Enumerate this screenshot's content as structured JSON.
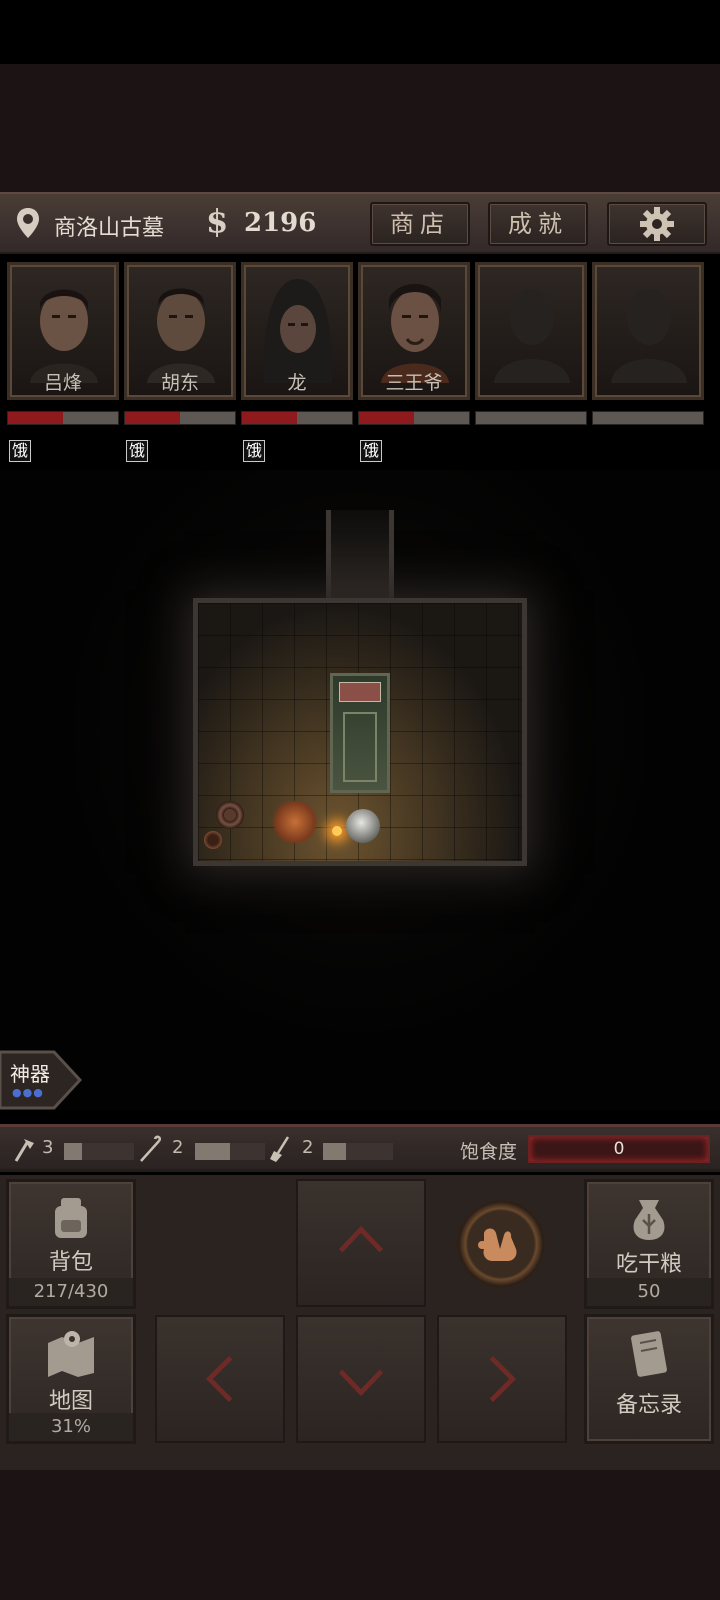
{
  "header": {
    "location": "商洛山古墓",
    "money_symbol": "$",
    "money": "2196",
    "shop_label": "商店",
    "achievements_label": "成就",
    "settings_icon": "gear-icon"
  },
  "party": [
    {
      "name": "吕烽",
      "hp": 0.5,
      "status": "饿"
    },
    {
      "name": "胡东",
      "hp": 0.5,
      "status": "饿"
    },
    {
      "name": "龙",
      "hp": 0.5,
      "status": "饿"
    },
    {
      "name": "三王爷",
      "hp": 0.5,
      "status": "饿"
    },
    {
      "name": "",
      "hp": 0,
      "status": ""
    },
    {
      "name": "",
      "hp": 0,
      "status": ""
    }
  ],
  "artifact": {
    "label": "神器",
    "dots": "●●●"
  },
  "tools": [
    {
      "icon": "axe-icon",
      "count": "3",
      "level": 0.25
    },
    {
      "icon": "hook-icon",
      "count": "2",
      "level": 0.5
    },
    {
      "icon": "shovel-icon",
      "count": "2",
      "level": 0.33
    }
  ],
  "satiety": {
    "label": "饱食度",
    "value": "0"
  },
  "controls": {
    "backpack": {
      "label": "背包",
      "value": "217/430"
    },
    "map": {
      "label": "地图",
      "value": "31%"
    },
    "eat": {
      "label": "吃干粮",
      "value": "50"
    },
    "memo": {
      "label": "备忘录"
    }
  },
  "colors": {
    "hp": "#8e1a1e",
    "accent": "#6a2222",
    "artifact_dots": "#4d6ed1"
  }
}
